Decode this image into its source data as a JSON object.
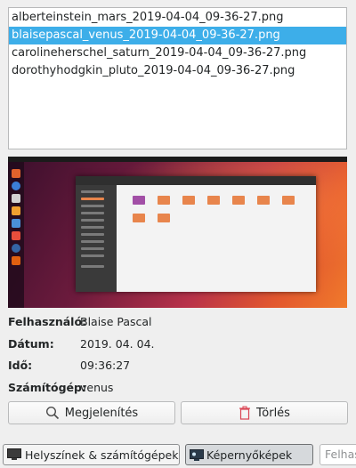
{
  "files": [
    "alberteinstein_mars_2019-04-04_09-36-27.png",
    "blaisepascal_venus_2019-04-04_09-36-27.png",
    "carolineherschel_saturn_2019-04-04_09-36-27.png",
    "dorothyhodgkin_pluto_2019-04-04_09-36-27.png"
  ],
  "selected_index": 1,
  "details": {
    "user_label": "Felhasználó:",
    "user_value": "Blaise Pascal",
    "date_label": "Dátum:",
    "date_value": "2019. 04. 04.",
    "time_label": "Idő:",
    "time_value": "09:36:27",
    "computer_label": "Számítógép:",
    "computer_value": "venus"
  },
  "actions": {
    "view_label": "Megjelenítés",
    "delete_label": "Törlés"
  },
  "bottom": {
    "locations_label": "Helyszínek & számítógépek",
    "screenshots_label": "Képernyőképek",
    "search_placeholder": "Felhasználó keresése"
  },
  "colors": {
    "selection": "#3daee9",
    "delete_icon": "#da4453"
  },
  "icons": {
    "view": "magnifier-icon",
    "delete": "trash-icon",
    "locations": "computer-icon",
    "screenshots": "screenshot-icon"
  }
}
